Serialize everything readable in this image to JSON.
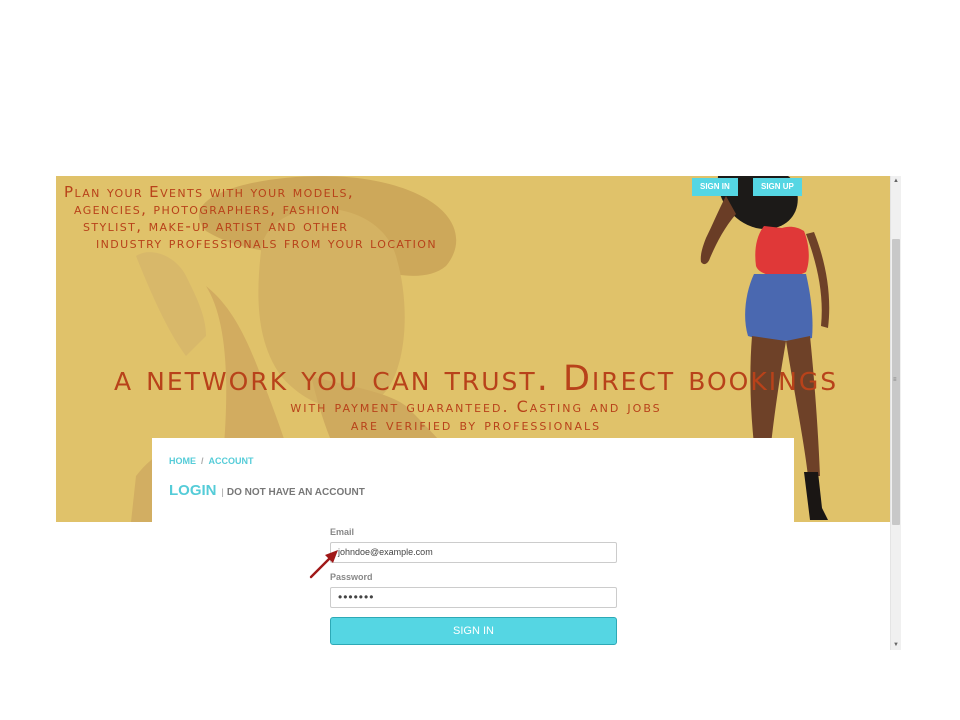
{
  "header": {
    "signin_label": "SIGN IN",
    "signup_label": "SIGN UP"
  },
  "hero": {
    "tagline": [
      "Plan your Events with your models,",
      "agencies, photographers, fashion",
      "stylist, make-up artist and other",
      "industry professionals from your location"
    ],
    "headline": [
      "a network you can trust. Direct bookings",
      "with payment guaranteed. Casting and jobs",
      "are verified by professionals"
    ]
  },
  "breadcrumb": {
    "home": "HOME",
    "separator": "/",
    "current": "ACCOUNT"
  },
  "login": {
    "title": "LOGIN",
    "separator": "|",
    "no_account_link": "DO NOT HAVE AN ACCOUNT"
  },
  "form": {
    "email_label": "Email",
    "email_value": "johndoe@example.com",
    "password_label": "Password",
    "password_value": "•••••••",
    "submit_label": "SIGN IN"
  },
  "colors": {
    "hero_bg": "#e0c26a",
    "text_orange": "#b8421a",
    "accent_cyan": "#55d6e3",
    "arrow_red": "#a01818"
  },
  "icons": {
    "annotation": "arrow-icon",
    "scroll_up": "chevron-up-icon",
    "scroll_down": "chevron-down-icon"
  }
}
